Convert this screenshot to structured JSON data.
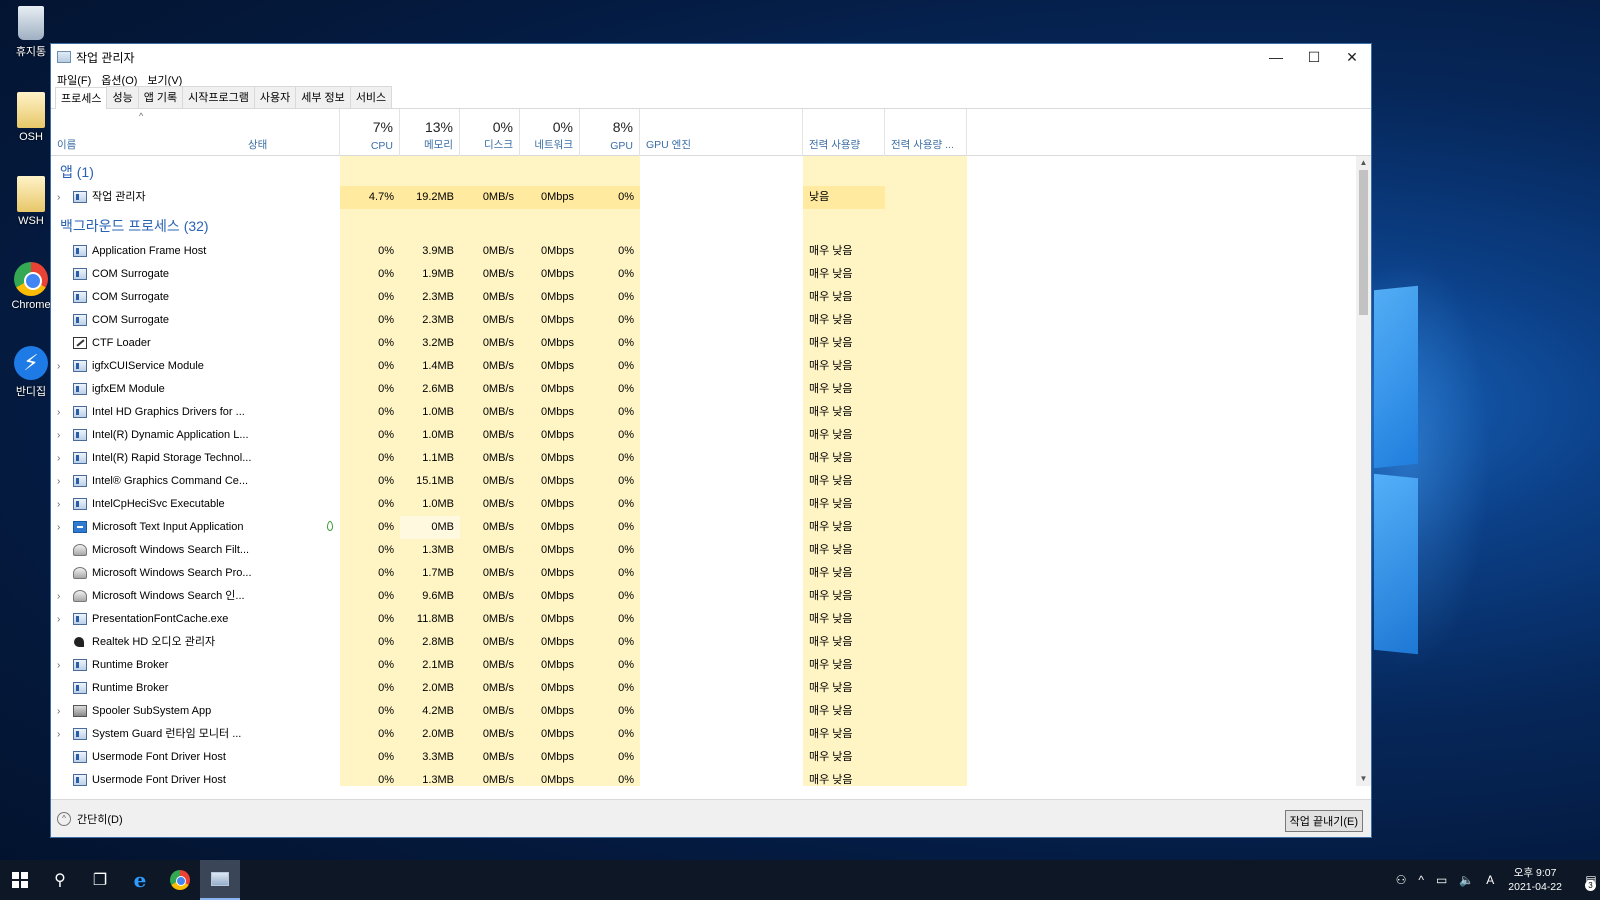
{
  "desktop": {
    "icons": [
      {
        "label": "휴지통",
        "icon": "recycle-bin-icon"
      },
      {
        "label": "OSH",
        "icon": "folder-icon"
      },
      {
        "label": "WSH",
        "icon": "folder-icon"
      },
      {
        "label": "Chrome",
        "icon": "chrome-icon"
      },
      {
        "label": "반디집",
        "icon": "bandizip-icon"
      }
    ]
  },
  "window": {
    "title": "작업 관리자",
    "controls": {
      "minimize": "—",
      "maximize": "☐",
      "close": "✕"
    },
    "menu": [
      "파일(F)",
      "옵션(O)",
      "보기(V)"
    ],
    "tabs": [
      "프로세스",
      "성능",
      "앱 기록",
      "시작프로그램",
      "사용자",
      "세부 정보",
      "서비스"
    ],
    "active_tab": "프로세스"
  },
  "header": {
    "name": "이름",
    "status": "상태",
    "cpu": {
      "pct": "7%",
      "label": "CPU"
    },
    "memory": {
      "pct": "13%",
      "label": "메모리"
    },
    "disk": {
      "pct": "0%",
      "label": "디스크"
    },
    "network": {
      "pct": "0%",
      "label": "네트워크"
    },
    "gpu": {
      "pct": "8%",
      "label": "GPU"
    },
    "gpu_engine": "GPU 엔진",
    "power": "전력 사용량",
    "power_trend": "전력 사용량 ..."
  },
  "groups": {
    "apps": "앱 (1)",
    "background": "백그라운드 프로세스 (32)"
  },
  "apps": [
    {
      "name": "작업 관리자",
      "expandable": true,
      "icon": "taskmgr",
      "cpu": "4.7%",
      "mem": "19.2MB",
      "disk": "0MB/s",
      "net": "0Mbps",
      "gpu": "0%",
      "power": "낮음"
    }
  ],
  "processes": [
    {
      "name": "Application Frame Host",
      "expandable": false,
      "icon": "app",
      "cpu": "0%",
      "mem": "3.9MB",
      "disk": "0MB/s",
      "net": "0Mbps",
      "gpu": "0%",
      "power": "매우 낮음"
    },
    {
      "name": "COM Surrogate",
      "expandable": false,
      "icon": "app",
      "cpu": "0%",
      "mem": "1.9MB",
      "disk": "0MB/s",
      "net": "0Mbps",
      "gpu": "0%",
      "power": "매우 낮음"
    },
    {
      "name": "COM Surrogate",
      "expandable": false,
      "icon": "app",
      "cpu": "0%",
      "mem": "2.3MB",
      "disk": "0MB/s",
      "net": "0Mbps",
      "gpu": "0%",
      "power": "매우 낮음"
    },
    {
      "name": "COM Surrogate",
      "expandable": false,
      "icon": "app",
      "cpu": "0%",
      "mem": "2.3MB",
      "disk": "0MB/s",
      "net": "0Mbps",
      "gpu": "0%",
      "power": "매우 낮음"
    },
    {
      "name": "CTF Loader",
      "expandable": false,
      "icon": "pen",
      "cpu": "0%",
      "mem": "3.2MB",
      "disk": "0MB/s",
      "net": "0Mbps",
      "gpu": "0%",
      "power": "매우 낮음"
    },
    {
      "name": "igfxCUIService Module",
      "expandable": true,
      "icon": "app",
      "cpu": "0%",
      "mem": "1.4MB",
      "disk": "0MB/s",
      "net": "0Mbps",
      "gpu": "0%",
      "power": "매우 낮음"
    },
    {
      "name": "igfxEM Module",
      "expandable": false,
      "icon": "app",
      "cpu": "0%",
      "mem": "2.6MB",
      "disk": "0MB/s",
      "net": "0Mbps",
      "gpu": "0%",
      "power": "매우 낮음"
    },
    {
      "name": "Intel HD Graphics Drivers for ...",
      "expandable": true,
      "icon": "app",
      "cpu": "0%",
      "mem": "1.0MB",
      "disk": "0MB/s",
      "net": "0Mbps",
      "gpu": "0%",
      "power": "매우 낮음"
    },
    {
      "name": "Intel(R) Dynamic Application L...",
      "expandable": true,
      "icon": "app",
      "cpu": "0%",
      "mem": "1.0MB",
      "disk": "0MB/s",
      "net": "0Mbps",
      "gpu": "0%",
      "power": "매우 낮음"
    },
    {
      "name": "Intel(R) Rapid Storage Technol...",
      "expandable": true,
      "icon": "app",
      "cpu": "0%",
      "mem": "1.1MB",
      "disk": "0MB/s",
      "net": "0Mbps",
      "gpu": "0%",
      "power": "매우 낮음"
    },
    {
      "name": "Intel® Graphics Command Ce...",
      "expandable": true,
      "icon": "app",
      "cpu": "0%",
      "mem": "15.1MB",
      "disk": "0MB/s",
      "net": "0Mbps",
      "gpu": "0%",
      "power": "매우 낮음"
    },
    {
      "name": "IntelCpHeciSvc Executable",
      "expandable": true,
      "icon": "app",
      "cpu": "0%",
      "mem": "1.0MB",
      "disk": "0MB/s",
      "net": "0Mbps",
      "gpu": "0%",
      "power": "매우 낮음"
    },
    {
      "name": "Microsoft Text Input Application",
      "expandable": true,
      "icon": "blue",
      "cpu": "0%",
      "mem": "0MB",
      "disk": "0MB/s",
      "net": "0Mbps",
      "gpu": "0%",
      "power": "매우 낮음",
      "suspended": true
    },
    {
      "name": "Microsoft Windows Search Filt...",
      "expandable": false,
      "icon": "person",
      "cpu": "0%",
      "mem": "1.3MB",
      "disk": "0MB/s",
      "net": "0Mbps",
      "gpu": "0%",
      "power": "매우 낮음"
    },
    {
      "name": "Microsoft Windows Search Pro...",
      "expandable": false,
      "icon": "person",
      "cpu": "0%",
      "mem": "1.7MB",
      "disk": "0MB/s",
      "net": "0Mbps",
      "gpu": "0%",
      "power": "매우 낮음"
    },
    {
      "name": "Microsoft Windows Search 인...",
      "expandable": true,
      "icon": "person",
      "cpu": "0%",
      "mem": "9.6MB",
      "disk": "0MB/s",
      "net": "0Mbps",
      "gpu": "0%",
      "power": "매우 낮음"
    },
    {
      "name": "PresentationFontCache.exe",
      "expandable": true,
      "icon": "app",
      "cpu": "0%",
      "mem": "11.8MB",
      "disk": "0MB/s",
      "net": "0Mbps",
      "gpu": "0%",
      "power": "매우 낮음"
    },
    {
      "name": "Realtek HD 오디오 관리자",
      "expandable": false,
      "icon": "speaker",
      "cpu": "0%",
      "mem": "2.8MB",
      "disk": "0MB/s",
      "net": "0Mbps",
      "gpu": "0%",
      "power": "매우 낮음"
    },
    {
      "name": "Runtime Broker",
      "expandable": true,
      "icon": "app",
      "cpu": "0%",
      "mem": "2.1MB",
      "disk": "0MB/s",
      "net": "0Mbps",
      "gpu": "0%",
      "power": "매우 낮음"
    },
    {
      "name": "Runtime Broker",
      "expandable": false,
      "icon": "app",
      "cpu": "0%",
      "mem": "2.0MB",
      "disk": "0MB/s",
      "net": "0Mbps",
      "gpu": "0%",
      "power": "매우 낮음"
    },
    {
      "name": "Spooler SubSystem App",
      "expandable": true,
      "icon": "printer",
      "cpu": "0%",
      "mem": "4.2MB",
      "disk": "0MB/s",
      "net": "0Mbps",
      "gpu": "0%",
      "power": "매우 낮음"
    },
    {
      "name": "System Guard 런타임 모니터 ...",
      "expandable": true,
      "icon": "app",
      "cpu": "0%",
      "mem": "2.0MB",
      "disk": "0MB/s",
      "net": "0Mbps",
      "gpu": "0%",
      "power": "매우 낮음"
    },
    {
      "name": "Usermode Font Driver Host",
      "expandable": false,
      "icon": "app",
      "cpu": "0%",
      "mem": "3.3MB",
      "disk": "0MB/s",
      "net": "0Mbps",
      "gpu": "0%",
      "power": "매우 낮음"
    },
    {
      "name": "Usermode Font Driver Host",
      "expandable": false,
      "icon": "app",
      "cpu": "0%",
      "mem": "1.3MB",
      "disk": "0MB/s",
      "net": "0Mbps",
      "gpu": "0%",
      "power": "매우 낮음"
    }
  ],
  "footer": {
    "fewer_details": "간단히(D)",
    "end_task": "작업 끝내기(E)"
  },
  "taskbar": {
    "clock_time": "오후 9:07",
    "clock_date": "2021-04-22",
    "ime": "A",
    "notification_count": "3"
  },
  "colors": {
    "heat_light": "#fff9e0",
    "heat_mid": "#fff4c4",
    "heat_strong": "#ffeaa0",
    "group_header": "#2a63b4",
    "header_label": "#3a6ea5"
  }
}
